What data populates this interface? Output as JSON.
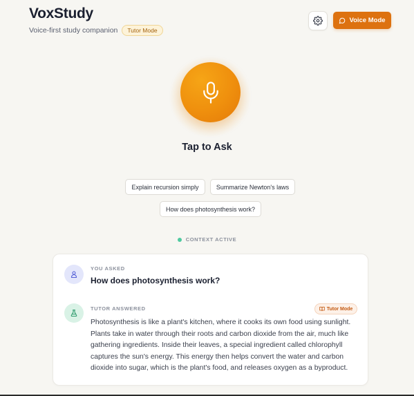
{
  "app": {
    "title": "VoxStudy",
    "subtitle": "Voice-first study companion",
    "mode_badge": "Tutor Mode"
  },
  "header": {
    "settings_icon": "gear-icon",
    "voice_button_label": "Voice Mode",
    "voice_button_icon": "chat-bubble-icon"
  },
  "mic": {
    "icon": "microphone-icon",
    "label": "Tap to Ask"
  },
  "suggestions": [
    "Explain recursion simply",
    "Summarize Newton's laws",
    "How does photosynthesis work?"
  ],
  "context": {
    "label": "CONTEXT ACTIVE"
  },
  "conversation": {
    "user_label": "YOU ASKED",
    "question": "How does photosynthesis work?",
    "tutor_label": "TUTOR ANSWERED",
    "tutor_badge": "Tutor Mode",
    "answer": "Photosynthesis is like a plant's kitchen, where it cooks its own food using sunlight. Plants take in water through their roots and carbon dioxide from the air, much like gathering ingredients. Inside their leaves, a special ingredient called chlorophyll captures the sun's energy. This energy then helps convert the water and carbon dioxide into sugar, which is the plant's food, and releases oxygen as a byproduct."
  },
  "colors": {
    "accent": "#dd7210",
    "mic_orange": "#ef8f0d",
    "context_dot": "#4fcaa0",
    "background": "#f7f6f2"
  }
}
